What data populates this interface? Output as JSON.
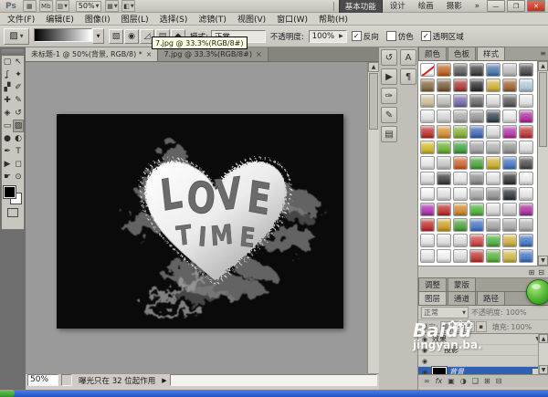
{
  "window": {
    "logo": "Ps",
    "appbar_icons_left": [
      {
        "name": "bridge-launcher-icon",
        "glyph": "▦",
        "dd": false
      },
      {
        "name": "mini-bridge-icon",
        "glyph": "Mb",
        "dd": false
      },
      {
        "name": "view-extras-icon",
        "glyph": "▥",
        "dd": true
      }
    ],
    "zoom": "50%",
    "appbar_icons_right": [
      {
        "name": "arrange-documents-icon",
        "glyph": "▦",
        "dd": true
      },
      {
        "name": "screen-mode-icon",
        "glyph": "◧",
        "dd": true
      }
    ],
    "workspaces": [
      "基本功能",
      "设计",
      "绘画",
      "摄影"
    ],
    "overflow": "»",
    "min": "—",
    "restore": "❐",
    "close": "✕"
  },
  "menu": [
    "文件(F)",
    "编辑(E)",
    "图像(I)",
    "图层(L)",
    "选择(S)",
    "滤镜(T)",
    "视图(V)",
    "窗口(W)",
    "帮助(H)"
  ],
  "options": {
    "gradient_tool_glyph": "▨",
    "gradient_types": [
      {
        "name": "linear-gradient-button",
        "glyph": "▧"
      },
      {
        "name": "radial-gradient-button",
        "glyph": "◉"
      },
      {
        "name": "angle-gradient-button",
        "glyph": "◿"
      },
      {
        "name": "reflected-gradient-button",
        "glyph": "▤"
      },
      {
        "name": "diamond-gradient-button",
        "glyph": "◆"
      }
    ],
    "mode_label": "模式:",
    "mode_value": "正常",
    "opacity_label": "不透明度:",
    "opacity_value": "100%",
    "checks": [
      {
        "label": "反向",
        "on": true
      },
      {
        "label": "仿色",
        "on": false
      },
      {
        "label": "透明区域",
        "on": true
      }
    ],
    "tooltip": "7.jpg @ 33.3%(RGB/8#)"
  },
  "doc": {
    "close_glyph": "×",
    "tabs": [
      {
        "label": "未标题-1 @ 50%(背景, RGB/8) *",
        "active": true
      },
      {
        "label": "7.jpg @ 33.3%(RGB/8#)",
        "active": false
      }
    ]
  },
  "tools": [
    {
      "name": "rectangular-marquee-tool",
      "glyph": "▢"
    },
    {
      "name": "move-tool",
      "glyph": "↖"
    },
    {
      "name": "lasso-tool",
      "glyph": "ʆ"
    },
    {
      "name": "quick-selection-tool",
      "glyph": "✦"
    },
    {
      "name": "crop-tool",
      "glyph": "▞"
    },
    {
      "name": "eyedropper-tool",
      "glyph": "✐"
    },
    {
      "name": "healing-brush-tool",
      "glyph": "✚"
    },
    {
      "name": "brush-tool",
      "glyph": "✎"
    },
    {
      "name": "clone-stamp-tool",
      "glyph": "◈"
    },
    {
      "name": "history-brush-tool",
      "glyph": "↺"
    },
    {
      "name": "eraser-tool",
      "glyph": "▭"
    },
    {
      "name": "gradient-tool",
      "glyph": "▨",
      "selected": true
    },
    {
      "name": "blur-tool",
      "glyph": "●"
    },
    {
      "name": "dodge-tool",
      "glyph": "◐"
    },
    {
      "name": "pen-tool",
      "glyph": "✒"
    },
    {
      "name": "type-tool",
      "glyph": "T"
    },
    {
      "name": "path-selection-tool",
      "glyph": "▶"
    },
    {
      "name": "shape-tool",
      "glyph": "◻"
    },
    {
      "name": "hand-tool",
      "glyph": "☛"
    },
    {
      "name": "zoom-tool",
      "glyph": "⊙"
    }
  ],
  "canvas_art": {
    "word1": "LOVE",
    "word2": "TIME"
  },
  "status": {
    "zoom": "50%",
    "message": "曝光只在 32 位起作用",
    "arrow": "▶"
  },
  "dock_icons": {
    "left": [
      {
        "name": "history-panel-icon",
        "glyph": "↺"
      },
      {
        "name": "actions-panel-icon",
        "glyph": "▶"
      },
      {
        "name": "tool-presets-panel-icon",
        "glyph": "✑"
      },
      {
        "name": "brush-presets-panel-icon",
        "glyph": "✎"
      },
      {
        "name": "layer-comps-panel-icon",
        "glyph": "▤"
      }
    ],
    "right": [
      {
        "name": "character-panel-icon",
        "glyph": "A"
      },
      {
        "name": "paragraph-panel-icon",
        "glyph": "¶"
      }
    ]
  },
  "styles_panel": {
    "tabs": [
      "颜色",
      "色板",
      "样式"
    ],
    "active_tab": 2,
    "panel_menu_glyph": "≡",
    "scroll_up": "▲",
    "scroll_down": "▼",
    "footer_icons": [
      {
        "name": "new-style-button",
        "glyph": "⊞"
      },
      {
        "name": "delete-style-button",
        "glyph": "⊟"
      }
    ],
    "swatches": [
      "none",
      "#c8651f",
      "#5d5d5d",
      "#3c3c3c",
      "#4779b2",
      "#c9c9c9",
      "#454545",
      "#8a6a3c",
      "#7b5a32",
      "#b23230",
      "#2a2a2a",
      "#d9ba35",
      "#a8622a",
      "#b9d3e6",
      "#d9c9a2",
      "#c9c9c0",
      "#7a6ab2",
      "#696969",
      "#e9e9e9",
      "#5a5a5a",
      "#f2f2f2",
      "#f2f2f2",
      "#e2e2e2",
      "#b2b2b2",
      "#9a9a9a",
      "#32424a",
      "#f5f5f5",
      "#b92aa2",
      "#c92a2a",
      "#e2932a",
      "#8aba32",
      "#3a6ac2",
      "#e9e9e9",
      "#ba32aa",
      "#c93232",
      "#dac222",
      "#6aba2a",
      "#3aaa3a",
      "#aaaaaa",
      "#bababa",
      "#9a9a9a",
      "#ededed",
      "#f5f5f5",
      "#d2d2d2",
      "#da622a",
      "#4aaa3a",
      "#dab92a",
      "#4279ca",
      "#4a4a4a",
      "#ededed",
      "#3a3a3a",
      "#f5f5f5",
      "#929292",
      "#ededed",
      "#323232",
      "#fafafa",
      "#ffffff",
      "#ededed",
      "#fafafa",
      "#b2b2b2",
      "#9a9a9a",
      "#2a323a",
      "#f2f2f2",
      "#ba2aba",
      "#c92a2a",
      "#da8a22",
      "#4aba32",
      "#e9e9e9",
      "#dddddd",
      "#b22aa2",
      "#c92a2a",
      "#daa222",
      "#4aaa3a",
      "#4279ca",
      "#aaaaaa",
      "#b2b2b2",
      "#bababa",
      "#f5f5f5",
      "#ededed",
      "#e9e9e9",
      "#da4242",
      "#4aba3a",
      "#dab93a",
      "#4279ca",
      "#f2f2f2",
      "#ffffff",
      "#e9e9e9",
      "#c93232",
      "#5aba3a",
      "#dac242",
      "#4279ca"
    ]
  },
  "mid_tabs": [
    "调整",
    "蒙版"
  ],
  "layers_panel": {
    "tabs": [
      "图层",
      "通道",
      "路径"
    ],
    "active_tab": 0,
    "blend": "正常",
    "opacity_label": "不透明度:",
    "opacity_value": "100%",
    "lock_label": "锁定:",
    "lock_icons": [
      "▨",
      "✎",
      "✛",
      "▪"
    ],
    "fill_label": "填充:",
    "fill_value": "100%",
    "eye_glyph": "◉",
    "expander_glyph": "▼",
    "rows": [
      {
        "kind": "effects",
        "label": "效果"
      },
      {
        "kind": "effect",
        "label": "投影"
      },
      {
        "kind": "effect",
        "label": ""
      },
      {
        "kind": "layer",
        "label": "背景",
        "selected": true
      }
    ],
    "footer_icons": [
      {
        "name": "link-layers-icon",
        "glyph": "∞"
      },
      {
        "name": "layer-style-icon",
        "glyph": "fx"
      },
      {
        "name": "add-mask-icon",
        "glyph": "▣"
      },
      {
        "name": "adjustment-layer-icon",
        "glyph": "◑"
      },
      {
        "name": "new-group-icon",
        "glyph": "❑"
      },
      {
        "name": "new-layer-icon",
        "glyph": "⊞"
      },
      {
        "name": "delete-layer-icon",
        "glyph": "⊟"
      }
    ]
  },
  "watermark": {
    "flowers": "✿❀✿",
    "brand": "Baidu",
    "site": "jingyan.ba."
  },
  "colors": {
    "selection_blue": "#2e62b0",
    "tooltip_bg": "#ffffe1",
    "taskbar_blue": "#245edb",
    "badge_green": "#3fae49",
    "canvas_bg": "#0a0a0a"
  }
}
